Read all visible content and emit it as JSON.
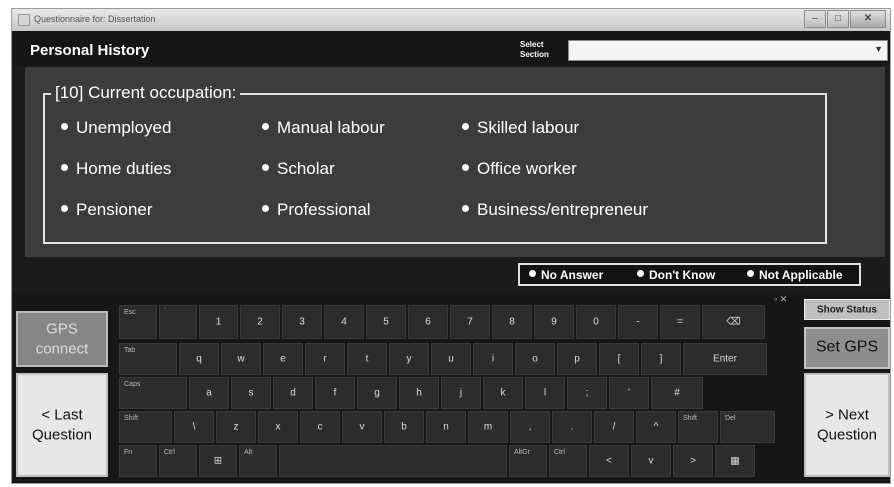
{
  "window": {
    "title": "Questionnaire for: Dissertation",
    "controls": [
      "minimize-icon",
      "maximize-icon",
      "close-icon"
    ]
  },
  "header": {
    "section_title": "Personal History",
    "select_label_1": "Select",
    "select_label_2": "Section",
    "select_value": ""
  },
  "question": {
    "label": "[10] Current occupation:",
    "options": [
      "Unemployed",
      "Manual labour",
      "Skilled labour",
      "Home duties",
      "Scholar",
      "Office worker",
      "Pensioner",
      "Professional",
      "Business/entrepreneur"
    ]
  },
  "answer_flags": [
    "No Answer",
    "Don't Know",
    "Not Applicable"
  ],
  "buttons": {
    "gps_connect_1": "GPS",
    "gps_connect_2": "connect",
    "last_question_1": "< Last",
    "last_question_2": "Question",
    "show_status": "Show Status",
    "set_gps": "Set GPS",
    "next_question_1": "> Next",
    "next_question_2": "Question"
  },
  "keyboard": {
    "row1": [
      {
        "main": "",
        "top": "Esc"
      },
      {
        "main": "",
        "top": "`"
      },
      {
        "main": "1",
        "top": ""
      },
      {
        "main": "2",
        "top": ""
      },
      {
        "main": "3",
        "top": ""
      },
      {
        "main": "4",
        "top": ""
      },
      {
        "main": "5",
        "top": ""
      },
      {
        "main": "6",
        "top": ""
      },
      {
        "main": "7",
        "top": ""
      },
      {
        "main": "8",
        "top": ""
      },
      {
        "main": "9",
        "top": ""
      },
      {
        "main": "0",
        "top": ""
      },
      {
        "main": "-",
        "top": ""
      },
      {
        "main": "=",
        "top": ""
      },
      {
        "main": "⌫",
        "top": ""
      }
    ],
    "row2": [
      {
        "main": "",
        "top": "Tab"
      },
      {
        "main": "q",
        "top": ""
      },
      {
        "main": "w",
        "top": ""
      },
      {
        "main": "e",
        "top": ""
      },
      {
        "main": "r",
        "top": ""
      },
      {
        "main": "t",
        "top": ""
      },
      {
        "main": "y",
        "top": ""
      },
      {
        "main": "u",
        "top": ""
      },
      {
        "main": "i",
        "top": ""
      },
      {
        "main": "o",
        "top": ""
      },
      {
        "main": "p",
        "top": ""
      },
      {
        "main": "[",
        "top": ""
      },
      {
        "main": "]",
        "top": ""
      },
      {
        "main": "Enter",
        "top": ""
      }
    ],
    "row3": [
      {
        "main": "",
        "top": "Caps"
      },
      {
        "main": "a",
        "top": ""
      },
      {
        "main": "s",
        "top": ""
      },
      {
        "main": "d",
        "top": ""
      },
      {
        "main": "f",
        "top": ""
      },
      {
        "main": "g",
        "top": ""
      },
      {
        "main": "h",
        "top": ""
      },
      {
        "main": "j",
        "top": ""
      },
      {
        "main": "k",
        "top": ""
      },
      {
        "main": "l",
        "top": ""
      },
      {
        "main": ";",
        "top": ""
      },
      {
        "main": "'",
        "top": ""
      },
      {
        "main": "#",
        "top": ""
      }
    ],
    "row4": [
      {
        "main": "",
        "top": "Shift"
      },
      {
        "main": "\\",
        "top": ""
      },
      {
        "main": "z",
        "top": ""
      },
      {
        "main": "x",
        "top": ""
      },
      {
        "main": "c",
        "top": ""
      },
      {
        "main": "v",
        "top": ""
      },
      {
        "main": "b",
        "top": ""
      },
      {
        "main": "n",
        "top": ""
      },
      {
        "main": "m",
        "top": ""
      },
      {
        "main": ",",
        "top": ""
      },
      {
        "main": ".",
        "top": ""
      },
      {
        "main": "/",
        "top": ""
      },
      {
        "main": "^",
        "top": ""
      },
      {
        "main": "",
        "top": "Shift"
      },
      {
        "main": "",
        "top": "Del"
      }
    ],
    "row5": [
      {
        "main": "",
        "top": "Fn"
      },
      {
        "main": "",
        "top": "Ctrl"
      },
      {
        "main": "⊞",
        "top": ""
      },
      {
        "main": "",
        "top": "Alt"
      },
      {
        "main": "",
        "top": ""
      },
      {
        "main": "",
        "top": "AltGr"
      },
      {
        "main": "",
        "top": "Ctrl"
      },
      {
        "main": "<",
        "top": ""
      },
      {
        "main": "v",
        "top": ""
      },
      {
        "main": ">",
        "top": ""
      },
      {
        "main": "▦",
        "top": ""
      }
    ]
  }
}
